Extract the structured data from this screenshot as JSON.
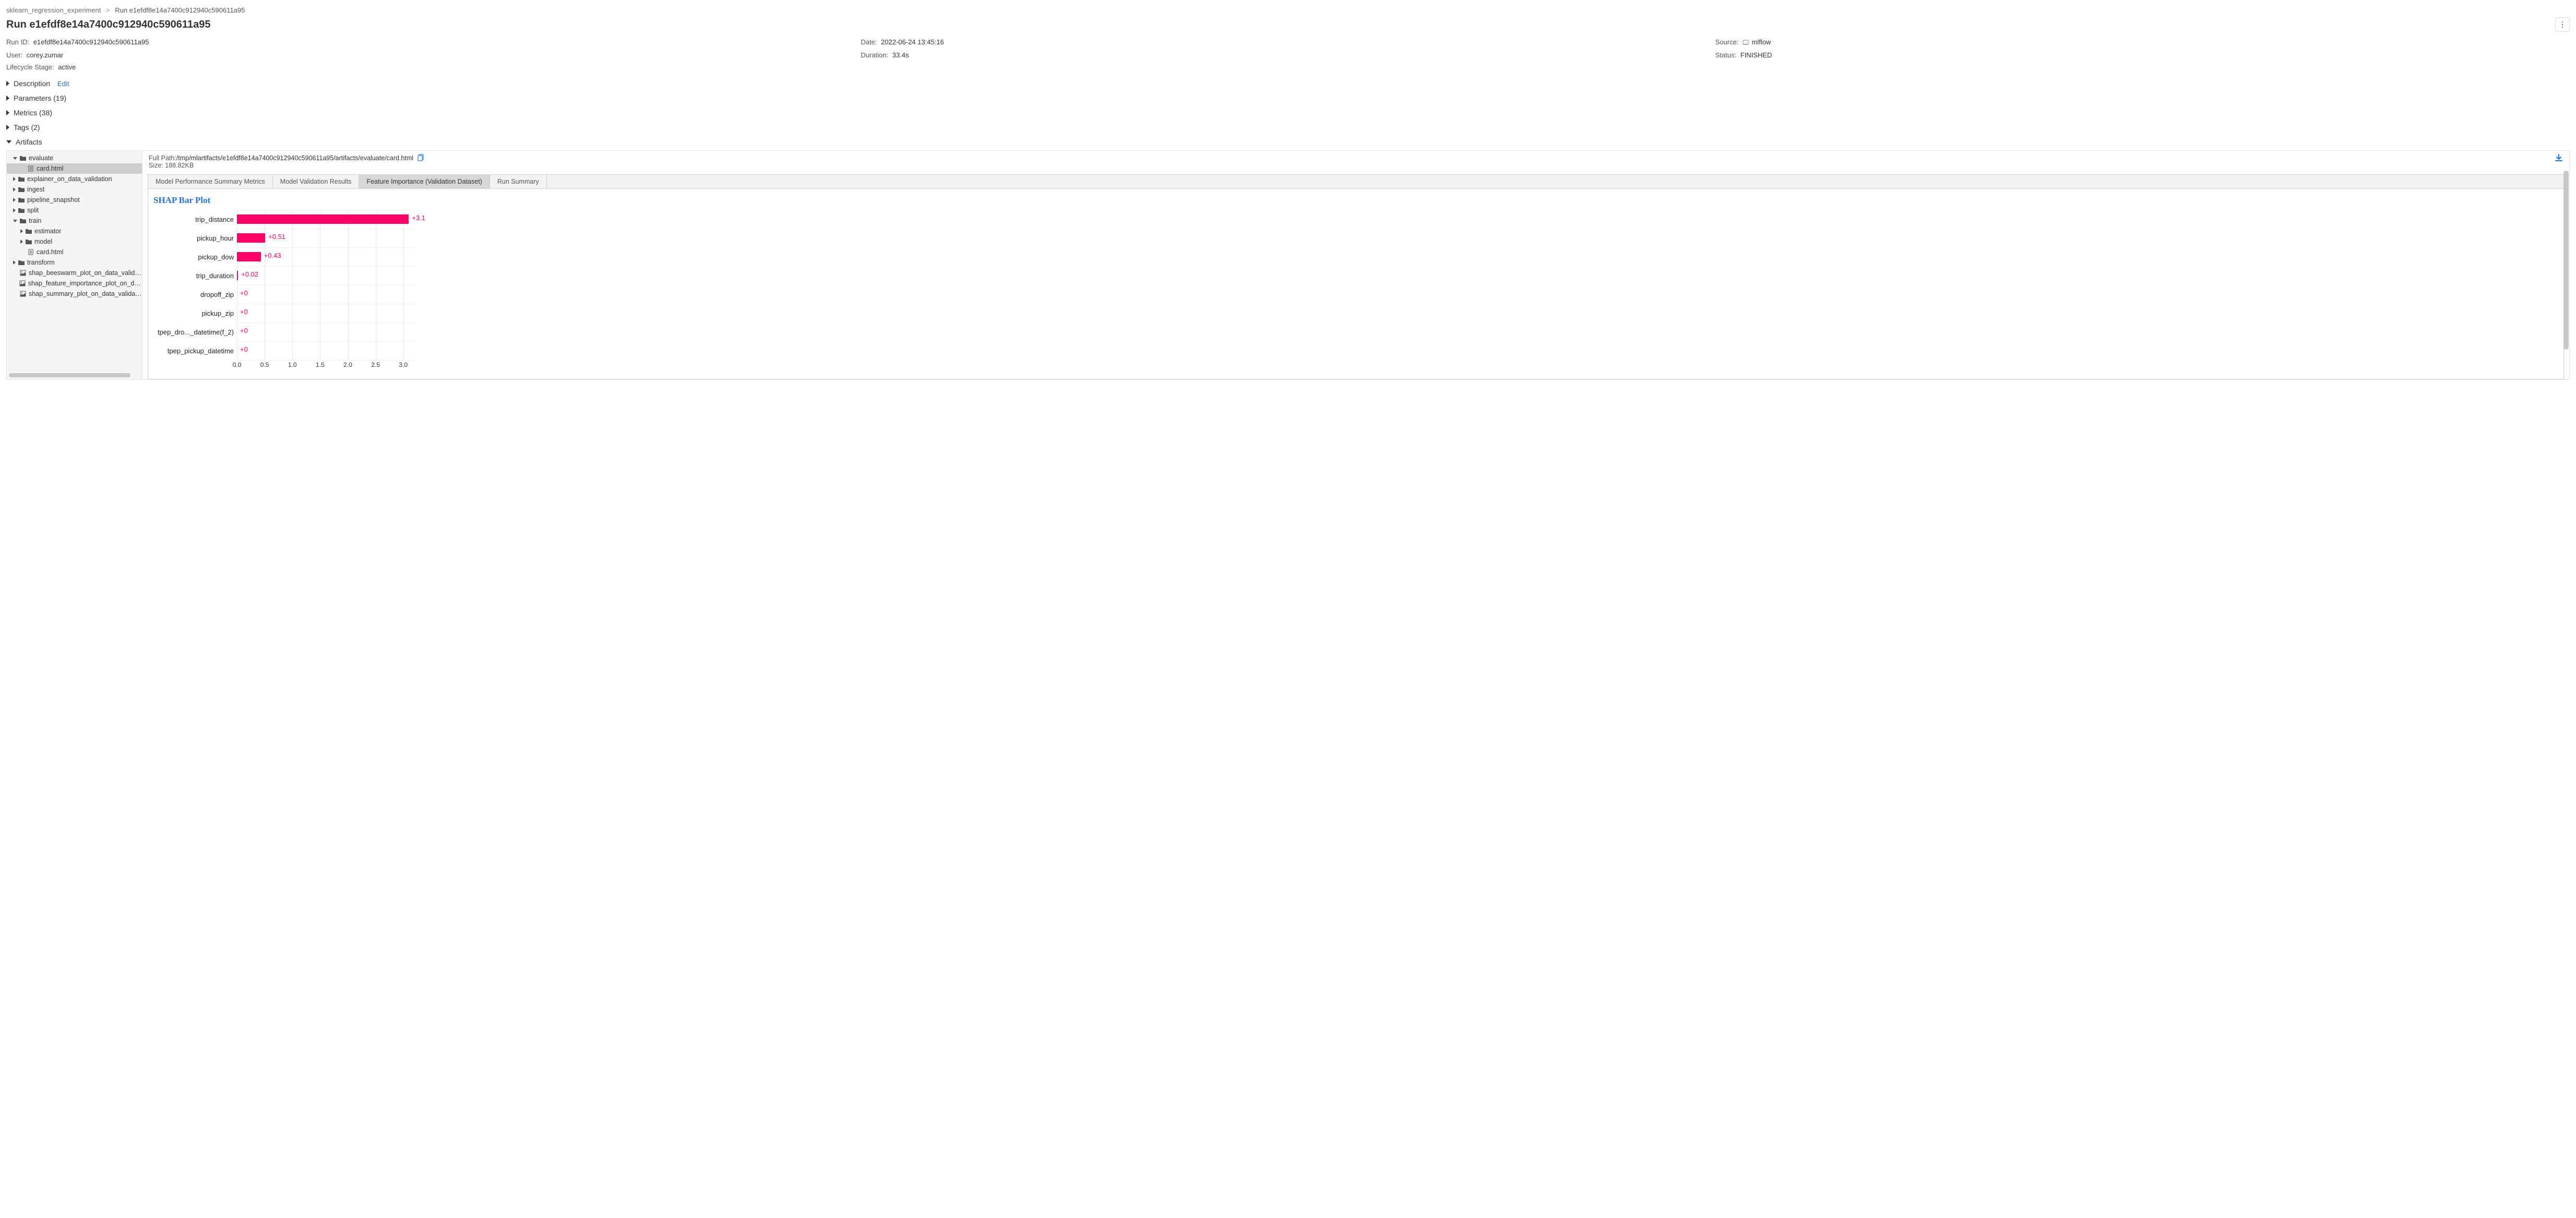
{
  "breadcrumb": {
    "experiment": "sklearn_regression_experiment",
    "run": "Run e1efdf8e14a7400c912940c590611a95"
  },
  "title": "Run e1efdf8e14a7400c912940c590611a95",
  "meta": {
    "run_id": {
      "label": "Run ID:",
      "value": "e1efdf8e14a7400c912940c590611a95"
    },
    "date": {
      "label": "Date:",
      "value": "2022-06-24 13:45:16"
    },
    "source": {
      "label": "Source:",
      "value": "mlflow"
    },
    "user": {
      "label": "User:",
      "value": "corey.zumar"
    },
    "duration": {
      "label": "Duration:",
      "value": "33.4s"
    },
    "status": {
      "label": "Status:",
      "value": "FINISHED"
    },
    "lifecycle": {
      "label": "Lifecycle Stage:",
      "value": "active"
    }
  },
  "sections": {
    "description": {
      "label": "Description",
      "edit": "Edit"
    },
    "parameters": "Parameters (19)",
    "metrics": "Metrics (38)",
    "tags": "Tags (2)",
    "artifacts": "Artifacts"
  },
  "tree": [
    {
      "depth": 0,
      "caret": "open",
      "icon": "folder",
      "label": "evaluate",
      "selected": false
    },
    {
      "depth": 1,
      "caret": "none",
      "icon": "file",
      "label": "card.html",
      "selected": true
    },
    {
      "depth": 0,
      "caret": "closed",
      "icon": "folder",
      "label": "explainer_on_data_validation",
      "selected": false
    },
    {
      "depth": 0,
      "caret": "closed",
      "icon": "folder",
      "label": "ingest",
      "selected": false
    },
    {
      "depth": 0,
      "caret": "closed",
      "icon": "folder",
      "label": "pipeline_snapshot",
      "selected": false
    },
    {
      "depth": 0,
      "caret": "closed",
      "icon": "folder",
      "label": "split",
      "selected": false
    },
    {
      "depth": 0,
      "caret": "open",
      "icon": "folder",
      "label": "train",
      "selected": false
    },
    {
      "depth": 1,
      "caret": "closed",
      "icon": "folder",
      "label": "estimator",
      "selected": false
    },
    {
      "depth": 1,
      "caret": "closed",
      "icon": "folder",
      "label": "model",
      "selected": false
    },
    {
      "depth": 1,
      "caret": "none",
      "icon": "file",
      "label": "card.html",
      "selected": false
    },
    {
      "depth": 0,
      "caret": "closed",
      "icon": "folder",
      "label": "transform",
      "selected": false
    },
    {
      "depth": 0,
      "caret": "none",
      "icon": "file-img",
      "label": "shap_beeswarm_plot_on_data_validation.png",
      "selected": false
    },
    {
      "depth": 0,
      "caret": "none",
      "icon": "file-img",
      "label": "shap_feature_importance_plot_on_data_validation.png",
      "selected": false
    },
    {
      "depth": 0,
      "caret": "none",
      "icon": "file-img",
      "label": "shap_summary_plot_on_data_validation.png",
      "selected": false
    }
  ],
  "viewer": {
    "full_path": {
      "label": "Full Path:",
      "value": "/tmp/mlartifacts/e1efdf8e14a7400c912940c590611a95/artifacts/evaluate/card.html"
    },
    "size": {
      "label": "Size:",
      "value": "188.82KB"
    },
    "tabs": [
      {
        "label": "Model Performance Summary Metrics",
        "active": false
      },
      {
        "label": "Model Validation Results",
        "active": false
      },
      {
        "label": "Feature Importance (Validation Dataset)",
        "active": true
      },
      {
        "label": "Run Summary",
        "active": false
      }
    ]
  },
  "chart_data": {
    "type": "bar",
    "orientation": "horizontal",
    "title": "SHAP Bar Plot",
    "categories": [
      "trip_distance",
      "pickup_hour",
      "pickup_dow",
      "trip_duration",
      "dropoff_zip",
      "pickup_zip",
      "tpep_dro..._datetime(f_2)",
      "tpep_pickup_datetime"
    ],
    "values": [
      3.1,
      0.51,
      0.43,
      0.02,
      0,
      0,
      0,
      0
    ],
    "value_labels": [
      "+3.1",
      "+0.51",
      "+0.43",
      "+0.02",
      "+0",
      "+0",
      "+0",
      "+0"
    ],
    "xlim": [
      0,
      3.2
    ],
    "xticks": [
      0.0,
      0.5,
      1.0,
      1.5,
      2.0,
      2.5,
      3.0
    ],
    "xtick_labels": [
      "0.0",
      "0.5",
      "1.0",
      "1.5",
      "2.0",
      "2.5",
      "3.0"
    ],
    "bar_color": "#ff0066",
    "label_color": "#ff0066"
  }
}
